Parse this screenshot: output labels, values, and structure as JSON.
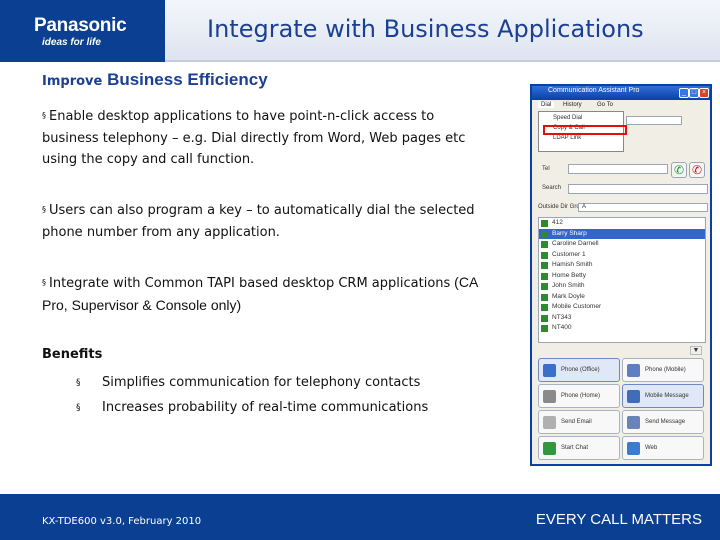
{
  "header": {
    "brand": "Panasonic",
    "tagline": "ideas for life",
    "title": "Integrate with Business Applications"
  },
  "content": {
    "subtitle_small": "Improve",
    "subtitle_large": "Business Efficiency",
    "bullets": [
      {
        "marker": "§",
        "text": "Enable desktop applications to have point-n-click access to business telephony – e.g. Dial directly from Word, Web pages etc using the copy and call function."
      },
      {
        "marker": "§",
        "text": "Users can also program a key – to automatically dial the selected phone number from any application."
      },
      {
        "marker": "§",
        "text_a": "Integrate with Common TAPI based desktop CRM applications",
        "text_b": " (CA Pro, Supervisor & Console only)"
      }
    ],
    "benefits_title": "Benefits",
    "benefits": [
      {
        "marker": "§",
        "text": "Simplifies communication for telephony contacts"
      },
      {
        "marker": "§",
        "text": "Increases probability of real-time communications"
      }
    ]
  },
  "screenshot": {
    "title": "Communication Assistant Pro",
    "window_buttons": {
      "minimize": "_",
      "maximize": "□",
      "close": "×"
    },
    "menu": [
      "Dial",
      "History",
      "Go To"
    ],
    "dropdown_items": [
      "Speed Dial",
      "Copy & Call",
      "LDAP Link"
    ],
    "search_label": "Search",
    "tel_label": "Tel",
    "group_label": "Outside Dir Group",
    "group_value": "A",
    "call_icon": "✆",
    "hangup_icon": "✆",
    "scroll_down": "▼",
    "contacts": [
      {
        "name": "412",
        "selected": false
      },
      {
        "name": "Barry Sharp",
        "selected": true
      },
      {
        "name": "Caroline Darnell",
        "selected": false
      },
      {
        "name": "Customer 1",
        "selected": false
      },
      {
        "name": "Hamish Smith",
        "selected": false
      },
      {
        "name": "Home Betty",
        "selected": false
      },
      {
        "name": "John Smith",
        "selected": false
      },
      {
        "name": "Mark Doyle",
        "selected": false
      },
      {
        "name": "Mobile Customer",
        "selected": false
      },
      {
        "name": "NT343",
        "selected": false
      },
      {
        "name": "NT400",
        "selected": false
      }
    ],
    "buttons": [
      {
        "label": "Phone (Office)",
        "icon_color": "#3c6fc9",
        "active": true
      },
      {
        "label": "Phone (Mobile)",
        "icon_color": "#5d7fc2",
        "active": false
      },
      {
        "label": "Phone (Home)",
        "icon_color": "#8a8a8a",
        "active": false
      },
      {
        "label": "Mobile Message",
        "icon_color": "#3f6db8",
        "active": true
      },
      {
        "label": "Send Email",
        "icon_color": "#b0b0b0",
        "active": false
      },
      {
        "label": "Send Message",
        "icon_color": "#6a84b8",
        "active": false
      },
      {
        "label": "Start Chat",
        "icon_color": "#2f9a3a",
        "active": false
      },
      {
        "label": "Web",
        "icon_color": "#3b7bd0",
        "active": false
      }
    ]
  },
  "footer": {
    "left": "KX-TDE600 v3.0, February 2010",
    "right": "EVERY CALL MATTERS"
  },
  "colors": {
    "brand_blue": "#0b3f91",
    "title_blue": "#1b3f93",
    "highlight_red": "#e01010"
  }
}
